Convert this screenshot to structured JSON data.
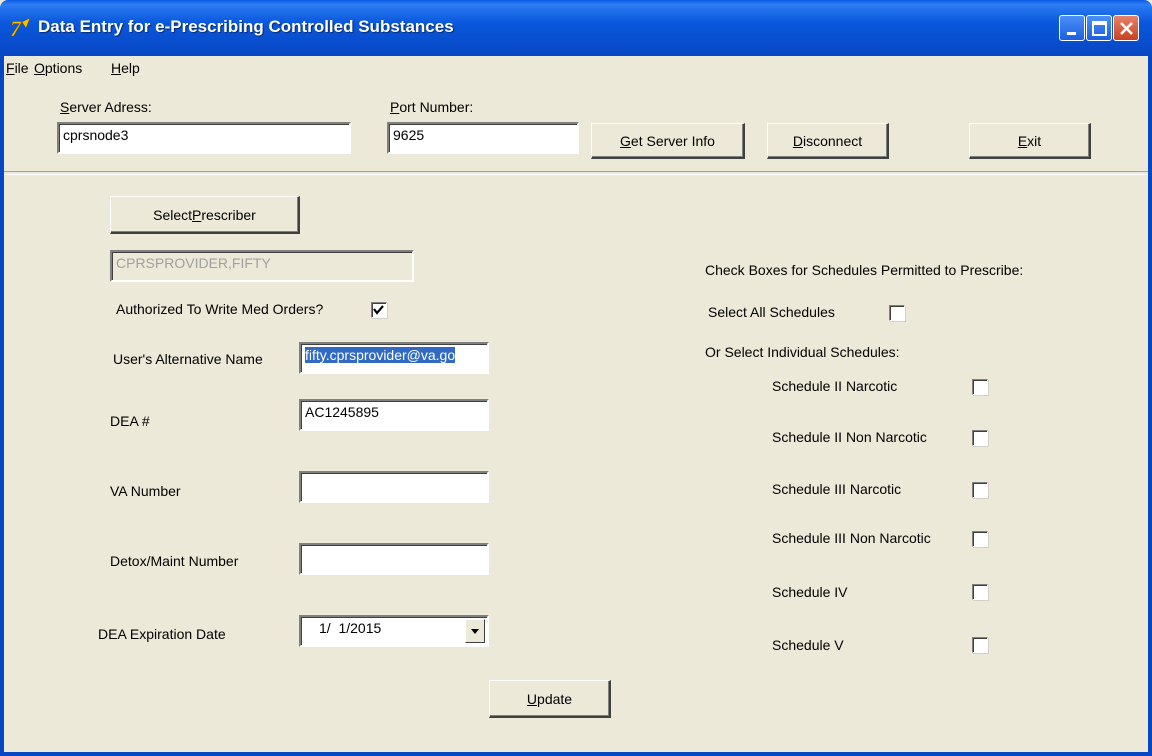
{
  "window": {
    "title": "Data Entry for e-Prescribing Controlled Substances"
  },
  "menu": {
    "file": {
      "first": "F",
      "rest": "ile"
    },
    "options": {
      "first": "O",
      "rest": "ptions"
    },
    "help": {
      "first": "H",
      "rest": "elp"
    }
  },
  "server": {
    "address_label_u": "S",
    "address_label_rest": "erver Adress:",
    "address_value": "cprsnode3",
    "port_label_u": "P",
    "port_label_rest": "ort Number:",
    "port_value": "9625"
  },
  "buttons": {
    "get_info_u": "G",
    "get_info_rest": "et Server Info",
    "disconnect_u": "D",
    "disconnect_rest": "isconnect",
    "exit_u": "E",
    "exit_rest": "xit",
    "select_prescriber_pre": "Select ",
    "select_prescriber_u": "P",
    "select_prescriber_rest": "rescriber",
    "update_u": "U",
    "update_rest": "pdate"
  },
  "prescriber": {
    "name": "CPRSPROVIDER,FIFTY",
    "authorized_label": "Authorized To Write Med Orders?",
    "authorized_checked": true,
    "alt_name_label": "User's Alternative Name",
    "alt_name_value": "fifty.cprsprovider@va.go",
    "dea_label": "DEA #",
    "dea_value": "AC1245895",
    "va_label": "VA Number",
    "va_value": "",
    "detox_label": "Detox/Maint Number",
    "detox_value": "",
    "exp_label": "DEA Expiration Date",
    "exp_value": "1/  1/2015"
  },
  "schedules": {
    "header": "Check Boxes for Schedules Permitted to Prescribe:",
    "select_all_label": "Select All Schedules",
    "individual_label": "Or Select Individual Schedules:",
    "items": [
      {
        "label": "Schedule II Narcotic",
        "checked": false
      },
      {
        "label": "Schedule II Non Narcotic",
        "checked": false
      },
      {
        "label": "Schedule III Narcotic",
        "checked": false
      },
      {
        "label": "Schedule III Non Narcotic",
        "checked": false
      },
      {
        "label": "Schedule IV",
        "checked": false
      },
      {
        "label": "Schedule V",
        "checked": false
      }
    ]
  },
  "colors": {
    "titlebar": "#0a58dd",
    "window_bg": "#ece9d8",
    "selection": "#316ac5",
    "close_button": "#c8411f"
  },
  "icons": {
    "app": "app-logo-icon",
    "minimize": "minimize-icon",
    "maximize": "maximize-icon",
    "close": "close-icon",
    "dropdown": "chevron-down-icon",
    "check": "checkmark-icon"
  }
}
